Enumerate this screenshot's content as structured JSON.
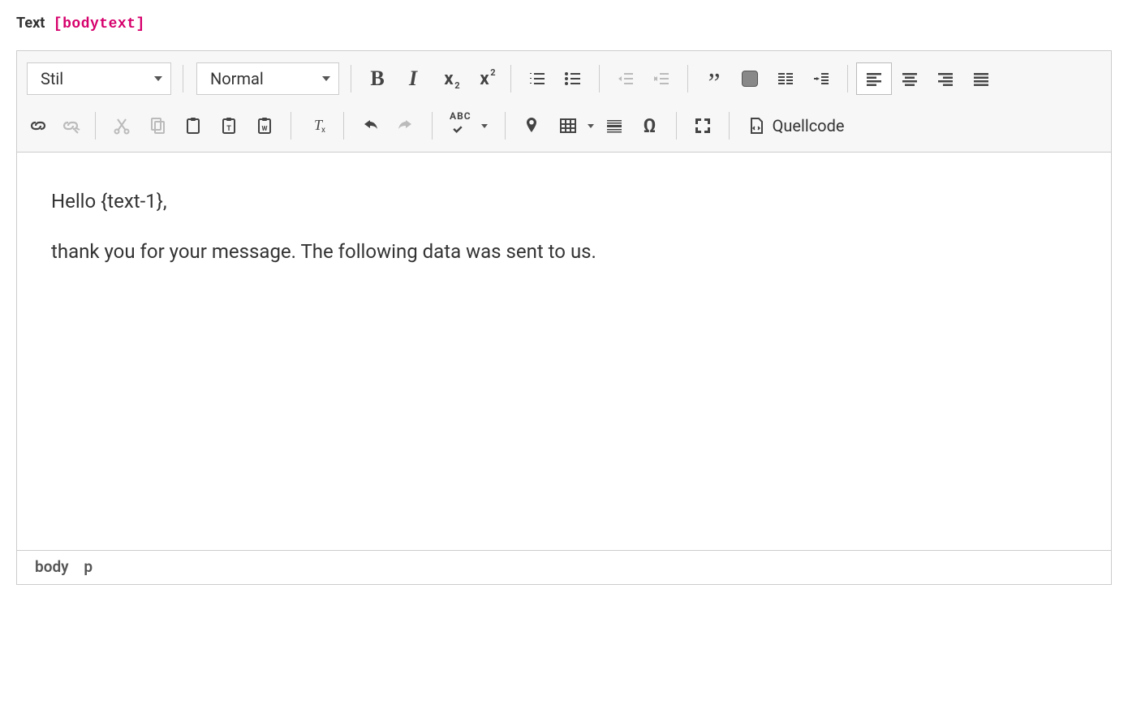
{
  "field": {
    "label": "Text",
    "tag": "[bodytext]"
  },
  "toolbar": {
    "style_combo": "Stil",
    "format_combo": "Normal",
    "spellcheck_text": "ABC",
    "source_label": "Quellcode"
  },
  "content": {
    "line1": "Hello {text-1},",
    "line2": "thank you for your message. The following data was sent to us."
  },
  "statusbar": {
    "path1": "body",
    "path2": "p"
  }
}
